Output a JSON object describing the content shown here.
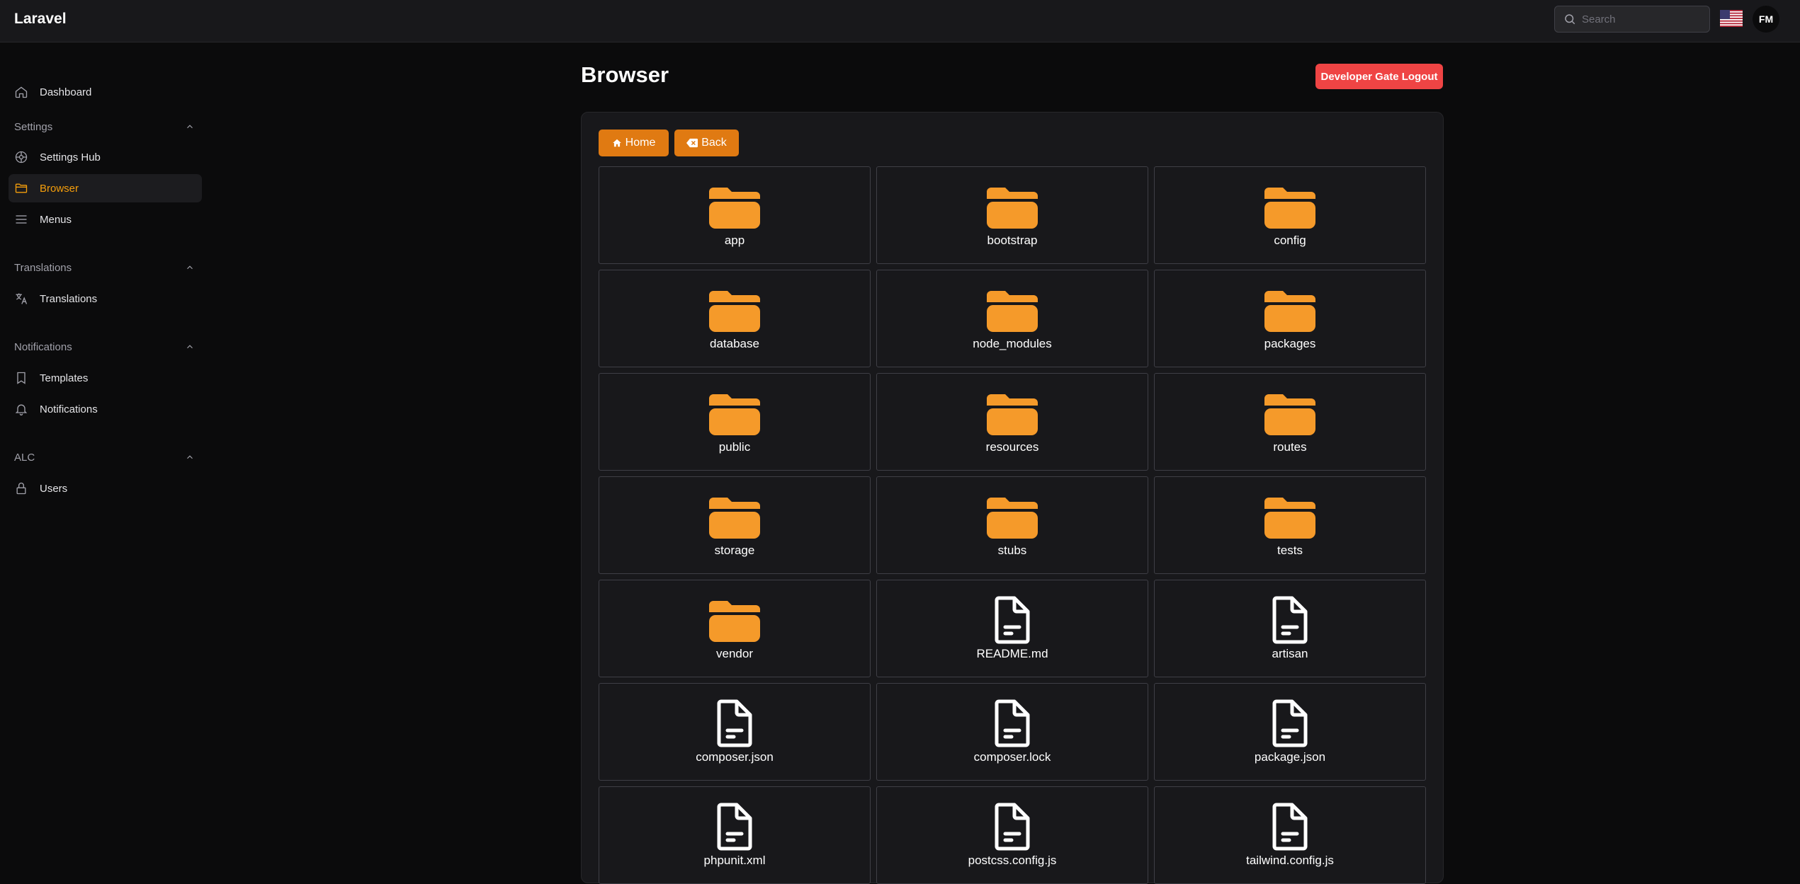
{
  "app": {
    "brand": "Laravel"
  },
  "header": {
    "search_placeholder": "Search",
    "avatar_initials": "FM"
  },
  "sidebar": {
    "dashboard": "Dashboard",
    "groups": [
      {
        "label": "Settings",
        "items": [
          "Settings Hub",
          "Browser",
          "Menus"
        ]
      },
      {
        "label": "Translations",
        "items": [
          "Translations"
        ]
      },
      {
        "label": "Notifications",
        "items": [
          "Templates",
          "Notifications"
        ]
      },
      {
        "label": "ALC",
        "items": [
          "Users"
        ]
      }
    ],
    "active_item": "Browser"
  },
  "main": {
    "title": "Browser",
    "logout_label": "Developer Gate Logout",
    "home_label": "Home",
    "back_label": "Back",
    "entries": [
      {
        "name": "app",
        "type": "folder"
      },
      {
        "name": "bootstrap",
        "type": "folder"
      },
      {
        "name": "config",
        "type": "folder"
      },
      {
        "name": "database",
        "type": "folder"
      },
      {
        "name": "node_modules",
        "type": "folder"
      },
      {
        "name": "packages",
        "type": "folder"
      },
      {
        "name": "public",
        "type": "folder"
      },
      {
        "name": "resources",
        "type": "folder"
      },
      {
        "name": "routes",
        "type": "folder"
      },
      {
        "name": "storage",
        "type": "folder"
      },
      {
        "name": "stubs",
        "type": "folder"
      },
      {
        "name": "tests",
        "type": "folder"
      },
      {
        "name": "vendor",
        "type": "folder"
      },
      {
        "name": "README.md",
        "type": "file"
      },
      {
        "name": "artisan",
        "type": "file"
      },
      {
        "name": "composer.json",
        "type": "file"
      },
      {
        "name": "composer.lock",
        "type": "file"
      },
      {
        "name": "package.json",
        "type": "file"
      },
      {
        "name": "phpunit.xml",
        "type": "file"
      },
      {
        "name": "postcss.config.js",
        "type": "file"
      },
      {
        "name": "tailwind.config.js",
        "type": "file"
      }
    ]
  },
  "colors": {
    "accent": "#f59e0b",
    "folder": "#f59a2a",
    "button": "#e07a12",
    "danger": "#ef4444",
    "background": "#0b0b0c",
    "panel": "#18181b"
  }
}
